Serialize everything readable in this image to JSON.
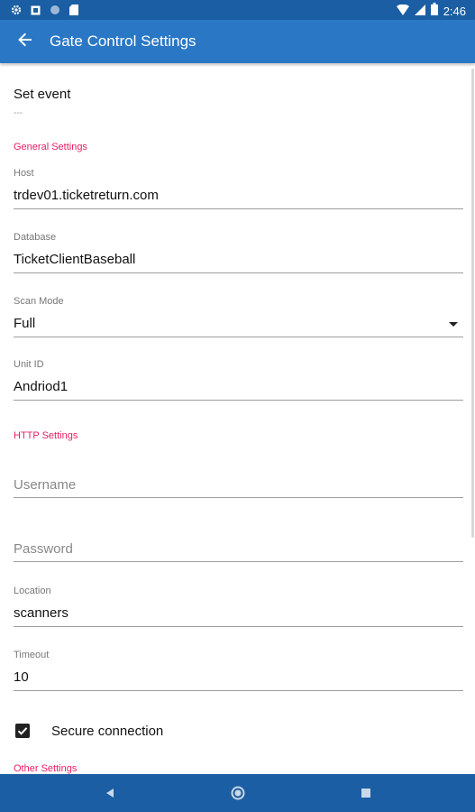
{
  "status_bar": {
    "time": "2:46",
    "icons": [
      "settings-icon",
      "notification-icon",
      "circle-icon",
      "sd-card-icon",
      "wifi-icon",
      "cell-signal-icon",
      "battery-icon"
    ]
  },
  "app_bar": {
    "title": "Gate Control Settings",
    "back_icon": "arrow-back-icon"
  },
  "set_event": {
    "label": "Set event",
    "value": "---"
  },
  "sections": {
    "general": "General Settings",
    "http": "HTTP Settings",
    "other": "Other Settings"
  },
  "fields": {
    "host": {
      "label": "Host",
      "value": "trdev01.ticketreturn.com"
    },
    "database": {
      "label": "Database",
      "value": "TicketClientBaseball"
    },
    "scan_mode": {
      "label": "Scan Mode",
      "value": "Full"
    },
    "unit_id": {
      "label": "Unit ID",
      "value": "Andriod1"
    },
    "username": {
      "placeholder": "Username"
    },
    "password": {
      "placeholder": "Password"
    },
    "location": {
      "label": "Location",
      "value": "scanners"
    },
    "timeout": {
      "label": "Timeout",
      "value": "10"
    }
  },
  "secure_connection": {
    "label": "Secure connection",
    "checked": true
  },
  "colors": {
    "status_bar": "#1b5ea3",
    "app_bar": "#2a77c6",
    "section_header": "#e91e63",
    "nav_bar": "#1b5ea3"
  },
  "nav_bar": {
    "icons": [
      "back-triangle-icon",
      "home-circle-icon",
      "recents-square-icon"
    ]
  }
}
